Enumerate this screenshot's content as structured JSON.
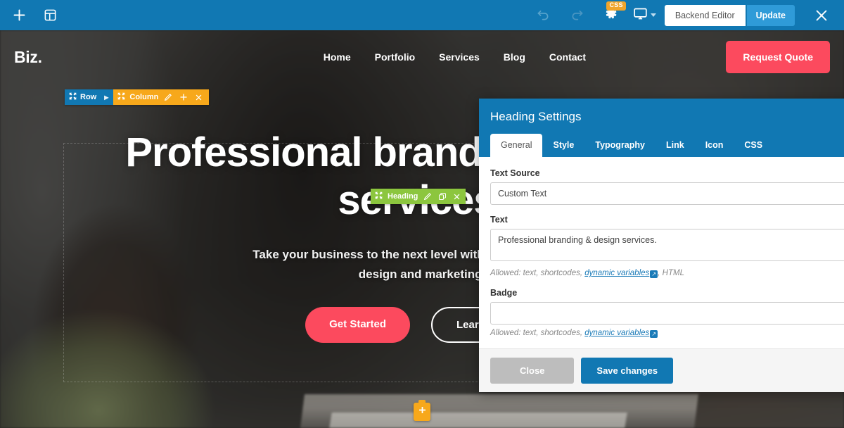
{
  "topbar": {
    "add_icon": "plus-icon",
    "layout_icon": "layout-template-icon",
    "undo_icon": "undo-icon",
    "redo_icon": "redo-icon",
    "gear_icon": "gear-icon",
    "css_badge": "CSS",
    "device_icon": "desktop-monitor-icon",
    "backend_editor_label": "Backend Editor",
    "update_label": "Update",
    "close_icon": "close-x-icon",
    "accent": "#1178b3",
    "update_color": "#2f9bd8",
    "badge_color": "#f0a52b"
  },
  "site": {
    "logo": "Biz.",
    "nav": [
      {
        "label": "Home"
      },
      {
        "label": "Portfolio"
      },
      {
        "label": "Services"
      },
      {
        "label": "Blog"
      },
      {
        "label": "Contact"
      }
    ],
    "quote_button": "Request Quote",
    "hero_title": "Professional branding & design services.",
    "hero_sub": "Take your business to the next level with our branding, web design and marketing.",
    "cta_primary": "Get Started",
    "cta_secondary": "Learn More",
    "primary_color": "#fc4a5e"
  },
  "builder": {
    "row_label": "Row",
    "row_expand_icon": "chevron-right-icon",
    "row_move_icon": "move-arrows-icon",
    "column_label": "Column",
    "column_move_icon": "move-arrows-icon",
    "column_edit_icon": "pencil-icon",
    "column_add_icon": "plus-icon",
    "column_close_icon": "close-x-icon",
    "heading_label": "Heading",
    "heading_move_icon": "move-arrows-icon",
    "heading_edit_icon": "pencil-icon",
    "heading_duplicate_icon": "duplicate-icon",
    "heading_close_icon": "close-x-icon",
    "add_element_icon": "plus-icon",
    "row_color": "#1178b3",
    "column_color": "#f7a81b",
    "heading_color": "#8cc63e"
  },
  "panel": {
    "title": "Heading Settings",
    "tabs": [
      {
        "label": "General",
        "active": true
      },
      {
        "label": "Style",
        "active": false
      },
      {
        "label": "Typography",
        "active": false
      },
      {
        "label": "Link",
        "active": false
      },
      {
        "label": "Icon",
        "active": false
      },
      {
        "label": "CSS",
        "active": false
      }
    ],
    "fields": {
      "text_source_label": "Text Source",
      "text_source_value": "Custom Text",
      "text_label": "Text",
      "text_value": "Professional branding & design services.",
      "text_help_prefix": "Allowed: text, shortcodes, ",
      "text_help_link": "dynamic variables",
      "text_help_suffix": ", HTML",
      "badge_label": "Badge",
      "badge_value": "",
      "badge_placeholder": "",
      "badge_help_prefix": "Allowed: text, shortcodes, ",
      "badge_help_link": "dynamic variables",
      "badge_help_suffix": "",
      "external_link_icon": "external-link-icon"
    },
    "footer": {
      "close_label": "Close",
      "save_label": "Save changes"
    }
  }
}
